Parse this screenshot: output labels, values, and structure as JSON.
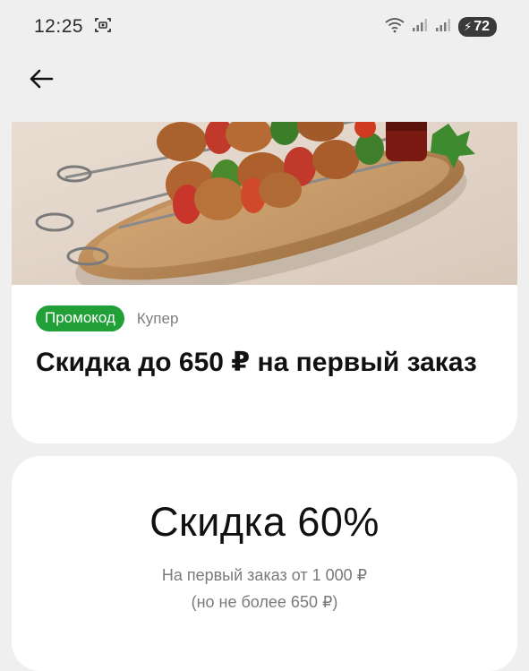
{
  "status_bar": {
    "time": "12:25",
    "battery_level": "72",
    "icons": [
      "screenshot-icon",
      "wifi-icon",
      "signal-icon",
      "signal-icon",
      "battery-charging-icon"
    ]
  },
  "nav": {
    "back_icon": "arrow-left-icon"
  },
  "promo": {
    "image_alt": "Shish kebab skewers on a wooden board",
    "badge": "Промокод",
    "store": "Купер",
    "title": "Скидка до 650 ₽ на первый заказ"
  },
  "discount": {
    "title": "Скидка 60%",
    "line1": "На первый заказ от 1 000 ₽",
    "line2": "(но не более 650 ₽)"
  },
  "colors": {
    "accent_green": "#21a038",
    "background": "#efefef",
    "card": "#ffffff"
  }
}
